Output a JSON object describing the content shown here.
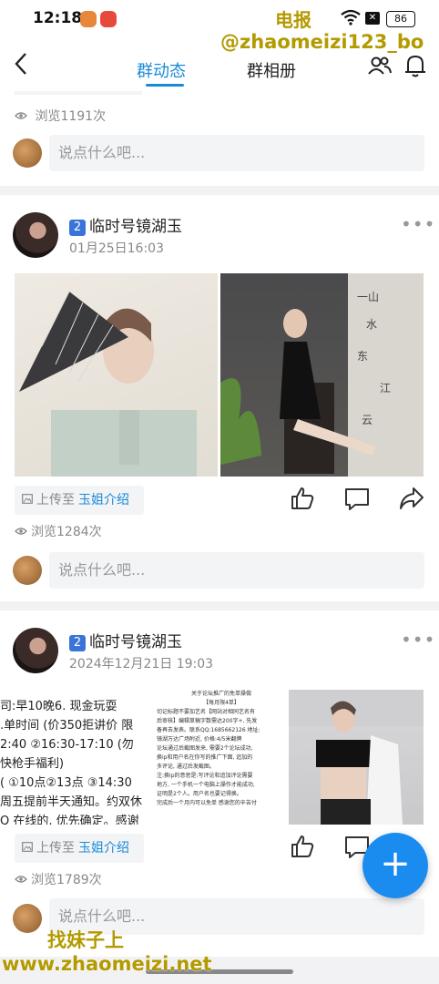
{
  "status": {
    "time": "12:18",
    "battery": "86"
  },
  "watermarks": {
    "top1": "电报",
    "top2": "@zhaomeizi123_bo",
    "bottom1": "找妹子上",
    "bottom2": "www.zhaomeizi.net"
  },
  "nav": {
    "tab_active": "群动态",
    "tab_other": "群相册"
  },
  "post0": {
    "views": "浏览1191次",
    "comment_placeholder": "说点什么吧..."
  },
  "post1": {
    "badge": "2",
    "author": "临时号镜湖玉",
    "date": "01月25日16:03",
    "upload_prefix": "上传至",
    "upload_tag": "玉姐介绍",
    "views": "浏览1284次",
    "comment_placeholder": "说点什么吧..."
  },
  "post2": {
    "badge": "2",
    "author": "临时号镜湖玉",
    "date": "2024年12月21日 19:03",
    "doc_lines": [
      "司:早10晚6. 现金玩耍",
      ".单时间 (价350拒讲价 限",
      "2:40 ②16:30-17:10 (勿",
      "快枪手福利)",
      "( ①10点②13点 ③14:30",
      "周五提前半天通知。约双休",
      "Q 在线的, 优先确定。感谢"
    ],
    "doc_right_title": "关于论坛推广的免单操做",
    "doc_right_sub": "【每月限4单】",
    "doc_right_lines": [
      "切记标题不要加艺名【网站对相同艺名有",
      "后审核】编辑草稿字数需达200字+, 先发",
      "备再去发表。联系QQ:1685662126 地址:",
      "镜湖万达广场附近, 价格:4/5米翻牌",
      "论坛通过后截图发来, 需要2个论坛成功,",
      "换ip和用户名在你写的推广下面, 追加的",
      "多评论, 通过后发截图。",
      "注:换ip的意思是:写评论和追加评论需要",
      "地方, 一个手机一个电脑上操作才能成功,",
      "证明是2个人。用户名也要记得换。",
      "完成后一个月内可以免单 感谢您的辛苦付"
    ],
    "upload_prefix": "上传至",
    "upload_tag": "玉姐介绍",
    "views": "浏览1789次",
    "comment_placeholder": "说点什么吧..."
  },
  "colors": {
    "accent": "#1a8ad8",
    "fab": "#1a8cf0",
    "badge": "#3b74d8",
    "watermark": "#b39a00"
  },
  "icons": [
    "back-icon",
    "group-members-icon",
    "bell-icon",
    "eye-icon",
    "image-icon",
    "like-icon",
    "comment-icon",
    "share-icon",
    "more-icon",
    "plus-icon"
  ]
}
